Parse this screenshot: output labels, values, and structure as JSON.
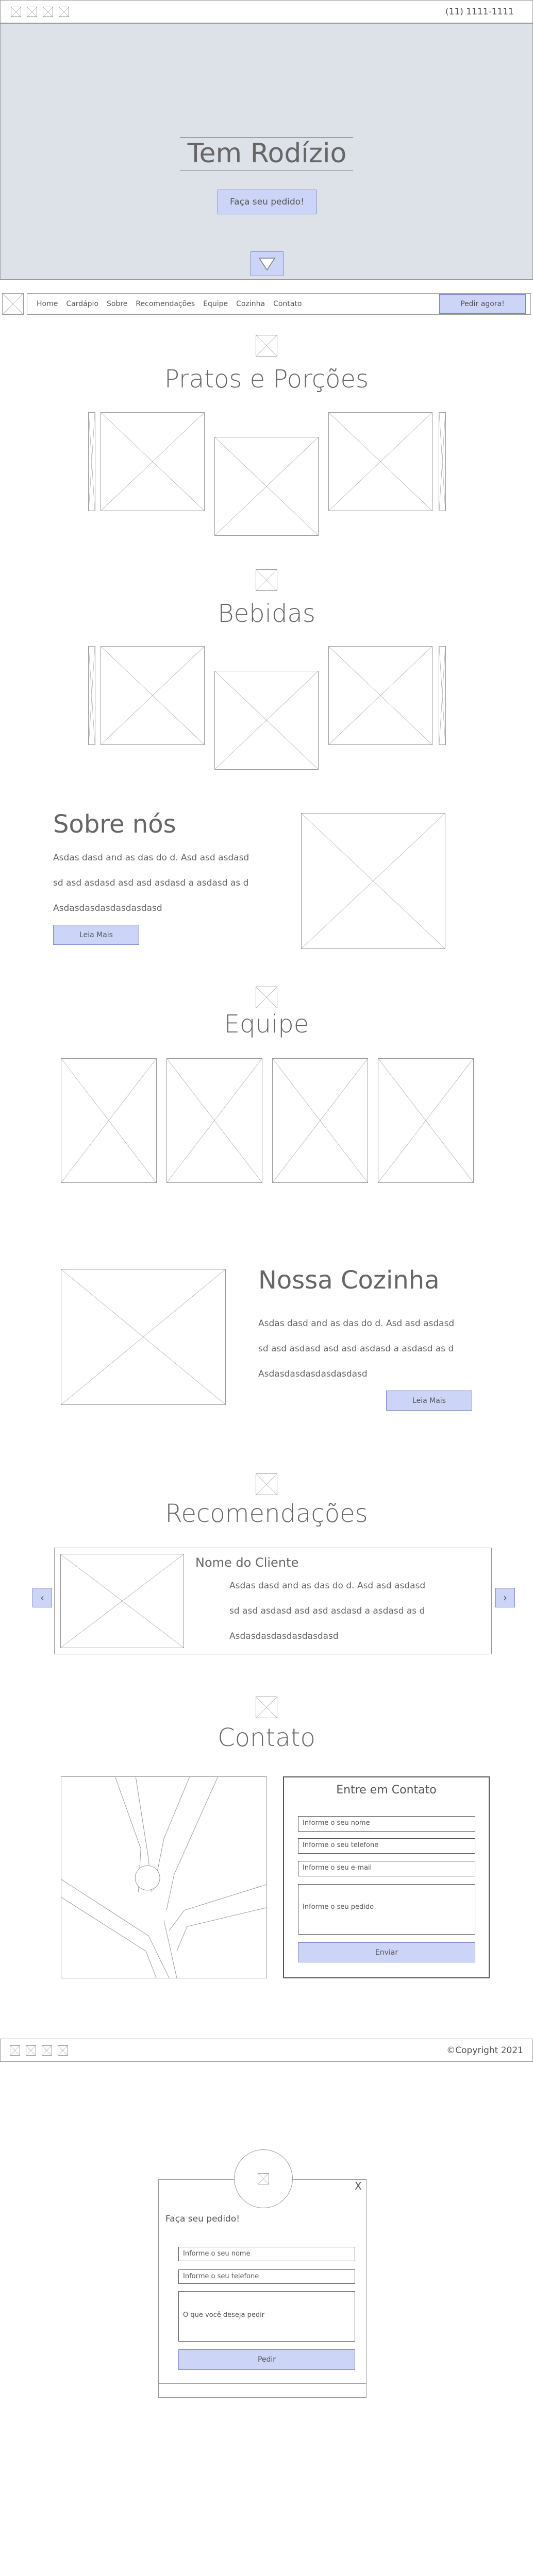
{
  "topbar": {
    "phone": "(11) 1111-1111",
    "social_icons": [
      "facebook-icon",
      "instagram-icon",
      "twitter-icon",
      "whatsapp-icon"
    ]
  },
  "hero": {
    "title": "Tem Rodízio",
    "cta": "Faça seu pedido!"
  },
  "nav": {
    "items": [
      "Home",
      "Cardápio",
      "Sobre",
      "Recomendações",
      "Equipe",
      "Cozinha",
      "Contato"
    ],
    "cta": "Pedir agora!"
  },
  "dishes": {
    "title": "Pratos e Porções"
  },
  "drinks": {
    "title": "Bebidas"
  },
  "about": {
    "title": "Sobre nós",
    "lines": [
      "Asdas dasd and as das do d. Asd asd asdasd",
      "sd asd asdasd asd asd asdasd a asdasd as d",
      "Asdasdasdasdasdasdasd"
    ],
    "button": "Leia Mais"
  },
  "team": {
    "title": "Equipe"
  },
  "kitchen": {
    "title": "Nossa Cozinha",
    "lines": [
      "Asdas dasd and as das do d. Asd asd asdasd",
      "sd asd asdasd asd asd asdasd a asdasd as d",
      "Asdasdasdasdasdasdasd"
    ],
    "button": "Leia Mais"
  },
  "recommendations": {
    "title": "Recomendações",
    "client": "Nome do Cliente",
    "lines": [
      "Asdas dasd and as das do d. Asd asd asdasd",
      "sd asd asdasd asd asd asdasd a asdasd as d",
      "Asdasdasdasdasdasdasd"
    ],
    "prev": "‹",
    "next": "›"
  },
  "contact": {
    "title": "Contato",
    "form_title": "Entre em Contato",
    "name_placeholder": "Informe o seu nome",
    "phone_placeholder": "Informe o seu telefone",
    "email_placeholder": "Informe o seu e-mail",
    "order_placeholder": "Informe o seu pedido",
    "send": "Enviar"
  },
  "footer": {
    "copyright": "©Copyright 2021"
  },
  "modal": {
    "title": "Faça seu pedido!",
    "close": "X",
    "name_placeholder": "Informe o seu nome",
    "phone_placeholder": "Informe o seu telefone",
    "order_placeholder": "O que você deseja pedir",
    "submit": "Pedir"
  }
}
